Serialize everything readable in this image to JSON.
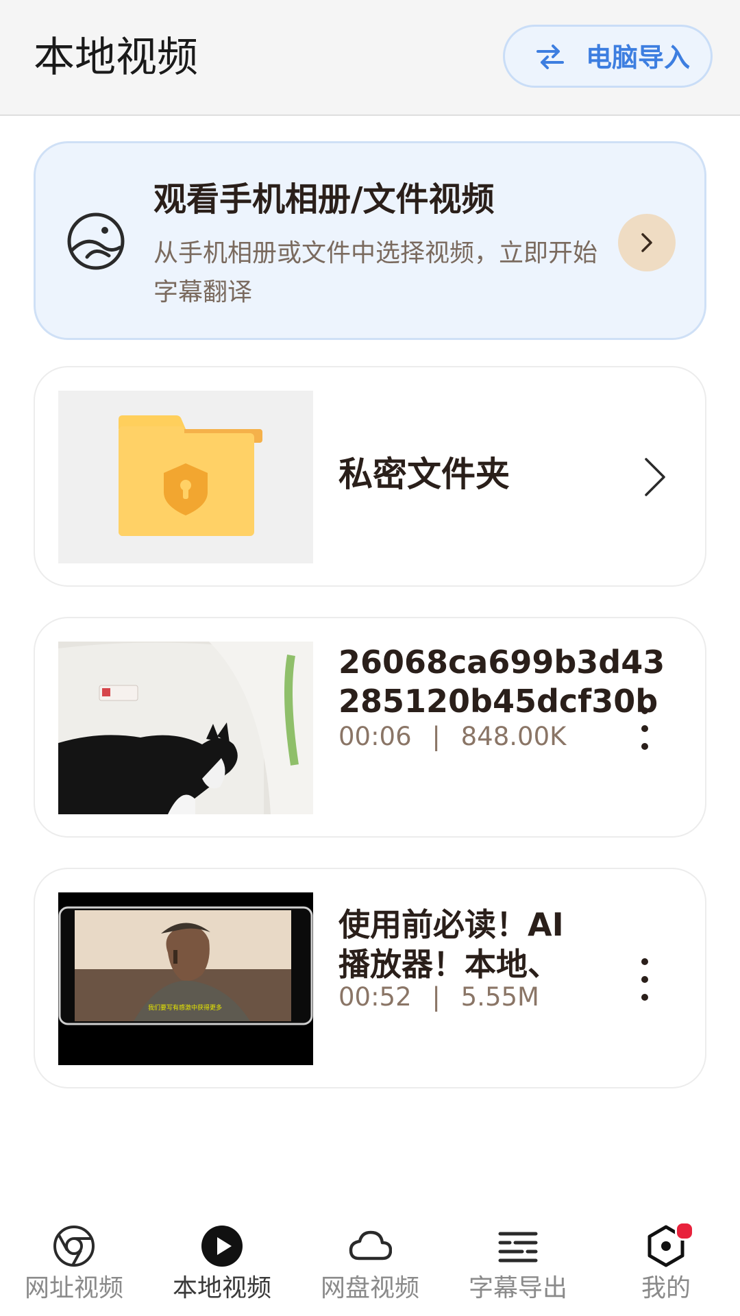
{
  "header": {
    "title": "本地视频",
    "import_button": "电脑导入"
  },
  "album_card": {
    "title": "观看手机相册/文件视频",
    "description": "从手机相册或文件中选择视频，立即开始字幕翻译"
  },
  "private_folder": {
    "label": "私密文件夹"
  },
  "videos": [
    {
      "title": "26068ca699b3d43285120b45dcf30b",
      "duration": "00:06",
      "separator": "|",
      "size": "848.00K"
    },
    {
      "title": "使用前必读！AI播放器！本地、",
      "duration": "00:52",
      "separator": "|",
      "size": "5.55M",
      "thumb_subtitle": "我们要写有感激中获得更多"
    }
  ],
  "tabbar": {
    "items": [
      {
        "label": "网址视频",
        "icon": "chrome-icon"
      },
      {
        "label": "本地视频",
        "icon": "play-icon"
      },
      {
        "label": "网盘视频",
        "icon": "cloud-icon"
      },
      {
        "label": "字幕导出",
        "icon": "subtitle-icon"
      },
      {
        "label": "我的",
        "icon": "profile-hex-icon"
      }
    ]
  },
  "colors": {
    "accent_blue": "#3d7ee0",
    "folder_yellow": "#ffd166",
    "folder_shield": "#f2a630",
    "badge_red": "#e8223c",
    "album_bg": "#edf4fd"
  }
}
